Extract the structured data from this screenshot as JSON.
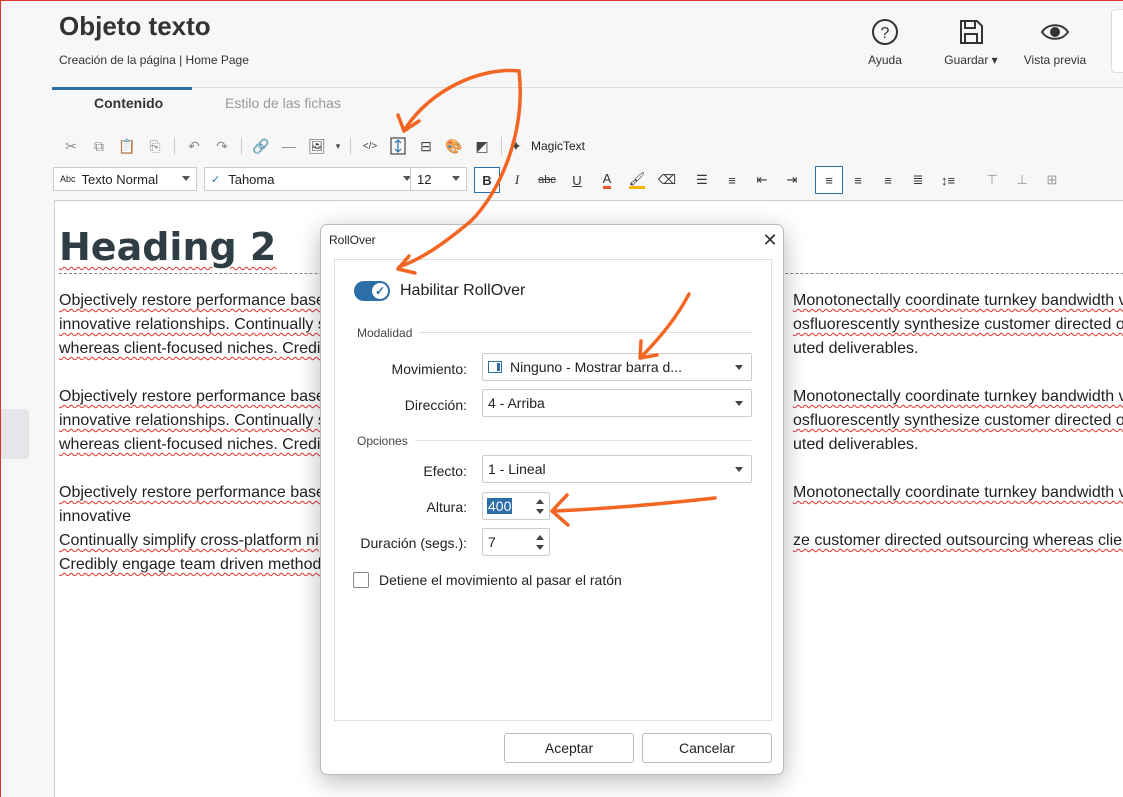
{
  "header": {
    "title": "Objeto texto",
    "subtitle": "Creación de la página | Home Page",
    "buttons": [
      {
        "label": "Ayuda",
        "icon": "help-icon"
      },
      {
        "label": "Guardar ▾",
        "icon": "save-icon"
      },
      {
        "label": "Vista previa",
        "icon": "eye-icon"
      }
    ]
  },
  "tabs": [
    {
      "label": "Contenido",
      "active": true
    },
    {
      "label": "Estilo de las fichas",
      "active": false
    }
  ],
  "toolbar": {
    "magictext_label": "MagicText",
    "style_combo": "Texto Normal",
    "style_prefix": "Abc",
    "font_combo": "Tahoma",
    "size_combo": "12",
    "bold": "B",
    "italic": "I",
    "strike": "abc",
    "underline": "U"
  },
  "editor": {
    "heading": "Heading 2",
    "paragraphs": [
      {
        "l1": "Objectively restore performance base",
        "l1r": "Monotonectally coordinate turnkey bandwidth v",
        "l2": "innovative relationships. Continually s",
        "l2r": "osfluorescently synthesize customer directed ou",
        "l3": "whereas client-focused niches. Credib",
        "l3r": "uted deliverables."
      },
      {
        "l1": "Objectively restore performance base",
        "l1r": "Monotonectally coordinate turnkey bandwidth v",
        "l2": "innovative relationships. Continually s",
        "l2r": "osfluorescently synthesize customer directed ou",
        "l3": "whereas client-focused niches. Credib",
        "l3r": "uted deliverables."
      },
      {
        "l1": "Objectively restore performance base",
        "l1r": "Monotonectally coordinate turnkey bandwidth v",
        "l2": "innovative",
        "l2r": "",
        "l3": "Continually simplify cross-platform ni",
        "l3r": "ze customer directed outsourcing whereas client-",
        "l4": "Credibly engage team driven method"
      }
    ]
  },
  "dialog": {
    "title": "RollOver",
    "close": "✕",
    "toggle_label": "Habilitar RollOver",
    "toggle_on": true,
    "section_modalidad": "Modalidad",
    "section_opciones": "Opciones",
    "movimiento_label": "Movimiento:",
    "movimiento_value": "Ninguno - Mostrar barra d...",
    "direccion_label": "Dirección:",
    "direccion_value": "4 - Arriba",
    "efecto_label": "Efecto:",
    "efecto_value": "1 - Lineal",
    "altura_label": "Altura:",
    "altura_value": "400",
    "duracion_label": "Duración (segs.):",
    "duracion_value": "7",
    "checkbox_label": "Detiene el movimiento al pasar el ratón",
    "checkbox_checked": false,
    "accept": "Aceptar",
    "cancel": "Cancelar"
  },
  "colors": {
    "accent": "#2b6ea8",
    "annotation": "#f26522"
  }
}
